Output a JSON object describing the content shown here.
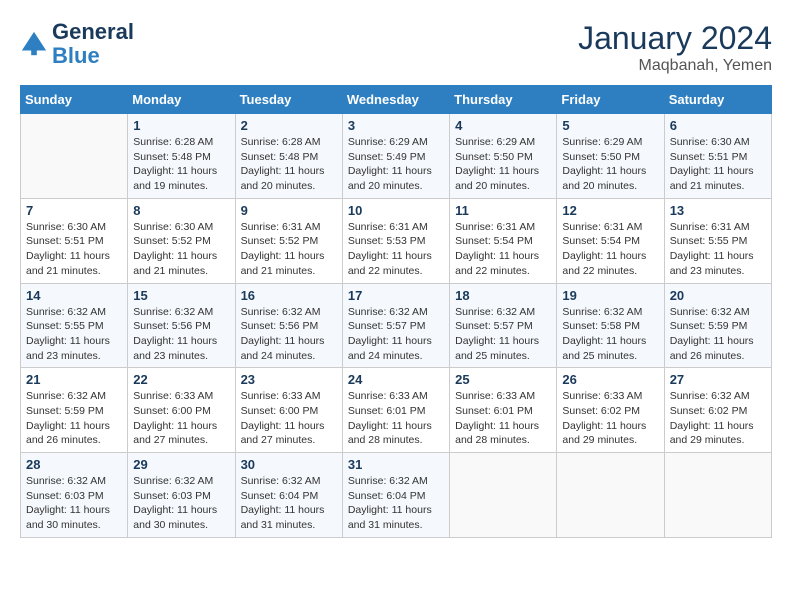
{
  "header": {
    "logo_line1": "General",
    "logo_line2": "Blue",
    "month": "January 2024",
    "location": "Maqbanah, Yemen"
  },
  "weekdays": [
    "Sunday",
    "Monday",
    "Tuesday",
    "Wednesday",
    "Thursday",
    "Friday",
    "Saturday"
  ],
  "weeks": [
    [
      {
        "day": "",
        "info": ""
      },
      {
        "day": "1",
        "info": "Sunrise: 6:28 AM\nSunset: 5:48 PM\nDaylight: 11 hours\nand 19 minutes."
      },
      {
        "day": "2",
        "info": "Sunrise: 6:28 AM\nSunset: 5:48 PM\nDaylight: 11 hours\nand 20 minutes."
      },
      {
        "day": "3",
        "info": "Sunrise: 6:29 AM\nSunset: 5:49 PM\nDaylight: 11 hours\nand 20 minutes."
      },
      {
        "day": "4",
        "info": "Sunrise: 6:29 AM\nSunset: 5:50 PM\nDaylight: 11 hours\nand 20 minutes."
      },
      {
        "day": "5",
        "info": "Sunrise: 6:29 AM\nSunset: 5:50 PM\nDaylight: 11 hours\nand 20 minutes."
      },
      {
        "day": "6",
        "info": "Sunrise: 6:30 AM\nSunset: 5:51 PM\nDaylight: 11 hours\nand 21 minutes."
      }
    ],
    [
      {
        "day": "7",
        "info": "Sunrise: 6:30 AM\nSunset: 5:51 PM\nDaylight: 11 hours\nand 21 minutes."
      },
      {
        "day": "8",
        "info": "Sunrise: 6:30 AM\nSunset: 5:52 PM\nDaylight: 11 hours\nand 21 minutes."
      },
      {
        "day": "9",
        "info": "Sunrise: 6:31 AM\nSunset: 5:52 PM\nDaylight: 11 hours\nand 21 minutes."
      },
      {
        "day": "10",
        "info": "Sunrise: 6:31 AM\nSunset: 5:53 PM\nDaylight: 11 hours\nand 22 minutes."
      },
      {
        "day": "11",
        "info": "Sunrise: 6:31 AM\nSunset: 5:54 PM\nDaylight: 11 hours\nand 22 minutes."
      },
      {
        "day": "12",
        "info": "Sunrise: 6:31 AM\nSunset: 5:54 PM\nDaylight: 11 hours\nand 22 minutes."
      },
      {
        "day": "13",
        "info": "Sunrise: 6:31 AM\nSunset: 5:55 PM\nDaylight: 11 hours\nand 23 minutes."
      }
    ],
    [
      {
        "day": "14",
        "info": "Sunrise: 6:32 AM\nSunset: 5:55 PM\nDaylight: 11 hours\nand 23 minutes."
      },
      {
        "day": "15",
        "info": "Sunrise: 6:32 AM\nSunset: 5:56 PM\nDaylight: 11 hours\nand 23 minutes."
      },
      {
        "day": "16",
        "info": "Sunrise: 6:32 AM\nSunset: 5:56 PM\nDaylight: 11 hours\nand 24 minutes."
      },
      {
        "day": "17",
        "info": "Sunrise: 6:32 AM\nSunset: 5:57 PM\nDaylight: 11 hours\nand 24 minutes."
      },
      {
        "day": "18",
        "info": "Sunrise: 6:32 AM\nSunset: 5:57 PM\nDaylight: 11 hours\nand 25 minutes."
      },
      {
        "day": "19",
        "info": "Sunrise: 6:32 AM\nSunset: 5:58 PM\nDaylight: 11 hours\nand 25 minutes."
      },
      {
        "day": "20",
        "info": "Sunrise: 6:32 AM\nSunset: 5:59 PM\nDaylight: 11 hours\nand 26 minutes."
      }
    ],
    [
      {
        "day": "21",
        "info": "Sunrise: 6:32 AM\nSunset: 5:59 PM\nDaylight: 11 hours\nand 26 minutes."
      },
      {
        "day": "22",
        "info": "Sunrise: 6:33 AM\nSunset: 6:00 PM\nDaylight: 11 hours\nand 27 minutes."
      },
      {
        "day": "23",
        "info": "Sunrise: 6:33 AM\nSunset: 6:00 PM\nDaylight: 11 hours\nand 27 minutes."
      },
      {
        "day": "24",
        "info": "Sunrise: 6:33 AM\nSunset: 6:01 PM\nDaylight: 11 hours\nand 28 minutes."
      },
      {
        "day": "25",
        "info": "Sunrise: 6:33 AM\nSunset: 6:01 PM\nDaylight: 11 hours\nand 28 minutes."
      },
      {
        "day": "26",
        "info": "Sunrise: 6:33 AM\nSunset: 6:02 PM\nDaylight: 11 hours\nand 29 minutes."
      },
      {
        "day": "27",
        "info": "Sunrise: 6:32 AM\nSunset: 6:02 PM\nDaylight: 11 hours\nand 29 minutes."
      }
    ],
    [
      {
        "day": "28",
        "info": "Sunrise: 6:32 AM\nSunset: 6:03 PM\nDaylight: 11 hours\nand 30 minutes."
      },
      {
        "day": "29",
        "info": "Sunrise: 6:32 AM\nSunset: 6:03 PM\nDaylight: 11 hours\nand 30 minutes."
      },
      {
        "day": "30",
        "info": "Sunrise: 6:32 AM\nSunset: 6:04 PM\nDaylight: 11 hours\nand 31 minutes."
      },
      {
        "day": "31",
        "info": "Sunrise: 6:32 AM\nSunset: 6:04 PM\nDaylight: 11 hours\nand 31 minutes."
      },
      {
        "day": "",
        "info": ""
      },
      {
        "day": "",
        "info": ""
      },
      {
        "day": "",
        "info": ""
      }
    ]
  ]
}
